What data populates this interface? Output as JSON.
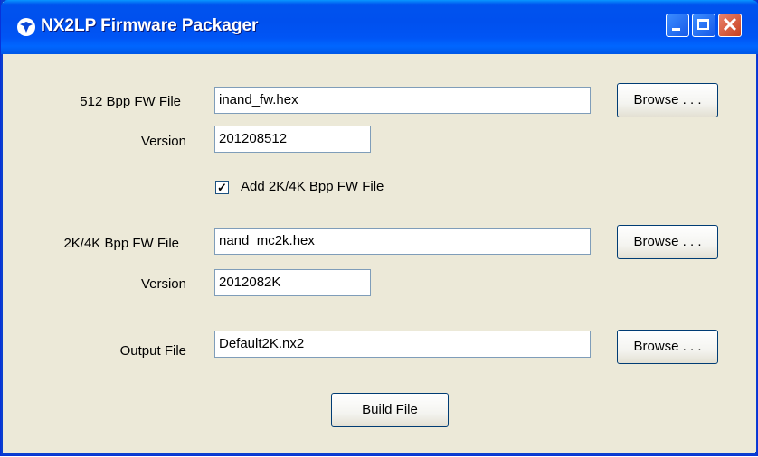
{
  "window": {
    "title": "NX2LP Firmware Packager",
    "buttons": {
      "minimize": "minimize",
      "maximize": "maximize",
      "close": "close"
    }
  },
  "fw512": {
    "label": "512 Bpp FW File",
    "file": "inand_fw.hex",
    "browse": "Browse . . .",
    "version_label": "Version",
    "version": "201208512"
  },
  "add2k": {
    "checked": true,
    "label": "Add 2K/4K Bpp FW File"
  },
  "fw2k": {
    "label": "2K/4K Bpp FW File",
    "file": "nand_mc2k.hex",
    "browse": "Browse . . .",
    "version_label": "Version",
    "version": "2012082K"
  },
  "output": {
    "label": "Output File",
    "file": "Default2K.nx2",
    "browse": "Browse . . ."
  },
  "build_button": "Build File"
}
